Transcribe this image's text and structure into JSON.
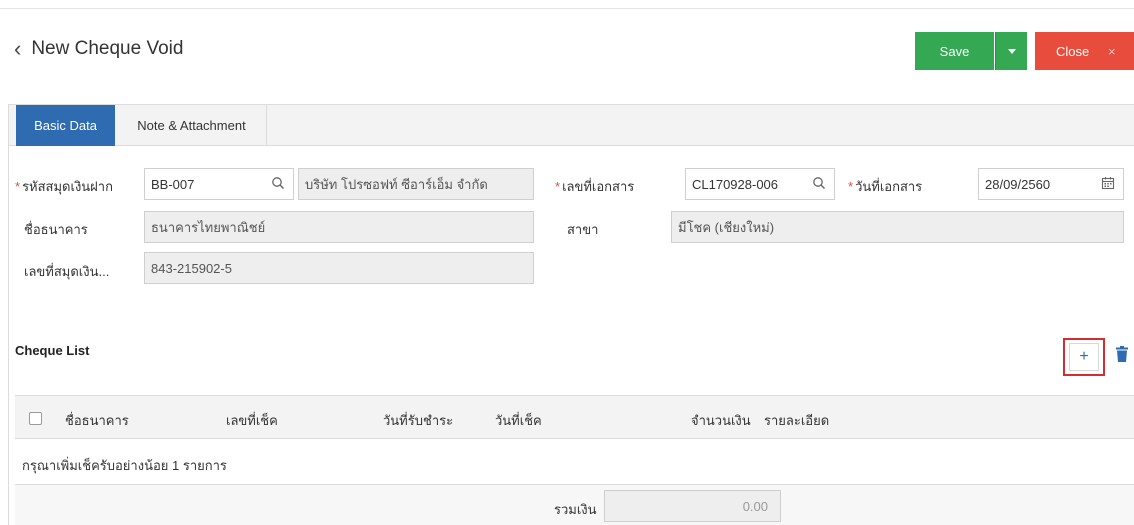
{
  "header": {
    "title": "New Cheque Void",
    "save_label": "Save",
    "close_label": "Close",
    "close_x": "×"
  },
  "tabs": [
    {
      "label": "Basic Data",
      "active": true
    },
    {
      "label": "Note & Attachment",
      "active": false
    }
  ],
  "form": {
    "bank_book_code": {
      "label": "รหัสสมุดเงินฝาก",
      "value": "BB-007",
      "name_value": "บริษัท โปรซอฟท์ ซีอาร์เอ็ม จำกัด",
      "required": "*"
    },
    "doc_no": {
      "label": "เลขที่เอกสาร",
      "value": "CL170928-006",
      "required": "*"
    },
    "doc_date": {
      "label": "วันที่เอกสาร",
      "value": "28/09/2560",
      "required": "*"
    },
    "bank_name": {
      "label": "ชื่อธนาคาร",
      "value": "ธนาคารไทยพาณิชย์"
    },
    "branch": {
      "label": "สาขา",
      "value": "มีโชค (เชียงใหม่)"
    },
    "account_no": {
      "label": "เลขที่สมุดเงิน...",
      "value": "843-215902-5"
    }
  },
  "cheque_list": {
    "title": "Cheque List",
    "add_symbol": "+",
    "columns": [
      "ชื่อธนาคาร",
      "เลขที่เช็ค",
      "วันที่รับชำระ",
      "วันที่เช็ค",
      "จำนวนเงิน",
      "รายละเอียด"
    ],
    "empty_message": "กรุณาเพิ่มเช็ครับอย่างน้อย 1 รายการ",
    "total_label": "รวมเงิน",
    "total_value": "0.00"
  },
  "colors": {
    "save": "#35a853",
    "close": "#e74c3c",
    "tab_active": "#2e6bb0",
    "highlight": "#d32f2f"
  }
}
